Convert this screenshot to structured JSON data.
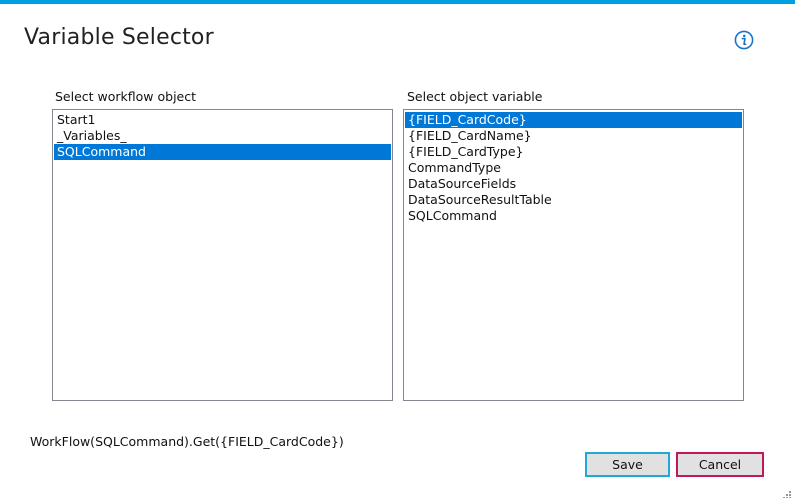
{
  "window": {
    "title": "Variable Selector",
    "accent_color": "#00a1de"
  },
  "info": {
    "icon": "info-icon",
    "color": "#1b73c8"
  },
  "workflow_objects": {
    "label": "Select workflow object",
    "items": [
      "Start1",
      "_Variables_",
      "SQLCommand"
    ],
    "selected_index": 2
  },
  "object_variables": {
    "label": "Select object variable",
    "items": [
      "{FIELD_CardCode}",
      "{FIELD_CardName}",
      "{FIELD_CardType}",
      "CommandType",
      "DataSourceFields",
      "DataSourceResultTable",
      "SQLCommand"
    ],
    "selected_index": 0
  },
  "expression": {
    "text": "WorkFlow(SQLCommand).Get({FIELD_CardCode})"
  },
  "buttons": {
    "save_label": "Save",
    "cancel_label": "Cancel",
    "save_border": "#1fa9d6",
    "cancel_border": "#c2185b"
  },
  "selection_color": "#0078d7"
}
